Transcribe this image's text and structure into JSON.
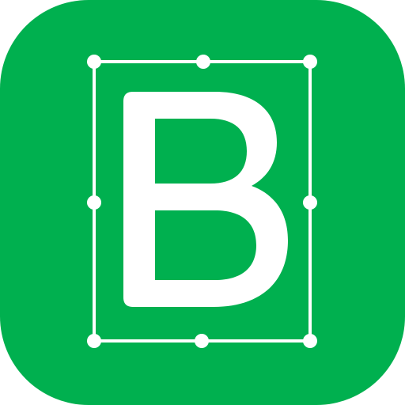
{
  "icon": {
    "letter": "B",
    "colors": {
      "background": "#00B04F",
      "foreground": "#FFFFFF"
    },
    "icon_name": "bounding-box-letter-b-icon"
  }
}
